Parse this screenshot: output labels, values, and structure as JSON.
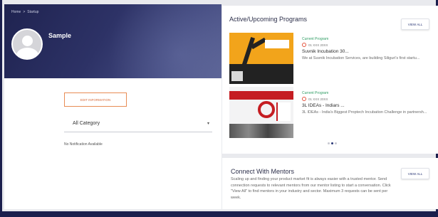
{
  "breadcrumb": {
    "home": "Home",
    "separator": ">",
    "current": "Startup"
  },
  "profile": {
    "name": "Sample"
  },
  "left": {
    "edit_button_label": "EDIT INFORMATION",
    "category_select_value": "All Category",
    "no_notification_text": "No Notification Available"
  },
  "programs": {
    "title": "Active/Upcoming Programs",
    "view_all_label": "VIEW ALL",
    "items": [
      {
        "status": "Current Program",
        "date": "01 XXX 20XX",
        "title": "Suvnik Incubation 30...",
        "description": "We at Suvnik Incubation Services, are building Siliguri's first startu..."
      },
      {
        "status": "Current Program",
        "date": "01 XXX 20XX",
        "title": "3L IDEAs - Indiars ...",
        "description": "3L IDEAs - India's Biggest Proptech Incubation Challenge in partnersh..."
      }
    ],
    "carousel_dots": 3,
    "active_dot": 1
  },
  "mentors": {
    "title": "Connect With Mentors",
    "view_all_label": "VIEW ALL",
    "description": "Scaling up and finding your product market fit is always easier with a trusted mentor. Send connection requests to relevant mentors from our mentor listing to start a conversation. Click \"View All\" to find mentors in your industry and sector. Maximum 3 requests can be sent per week."
  },
  "colors": {
    "hero_dark": "#1f2350",
    "accent_orange": "#e88c55",
    "status_green": "#2e9c63",
    "brand_navy": "#2c3a78"
  },
  "icons": {
    "avatar": "user-silhouette-icon",
    "chevron": "chevron-down-icon",
    "date": "clock-icon"
  }
}
